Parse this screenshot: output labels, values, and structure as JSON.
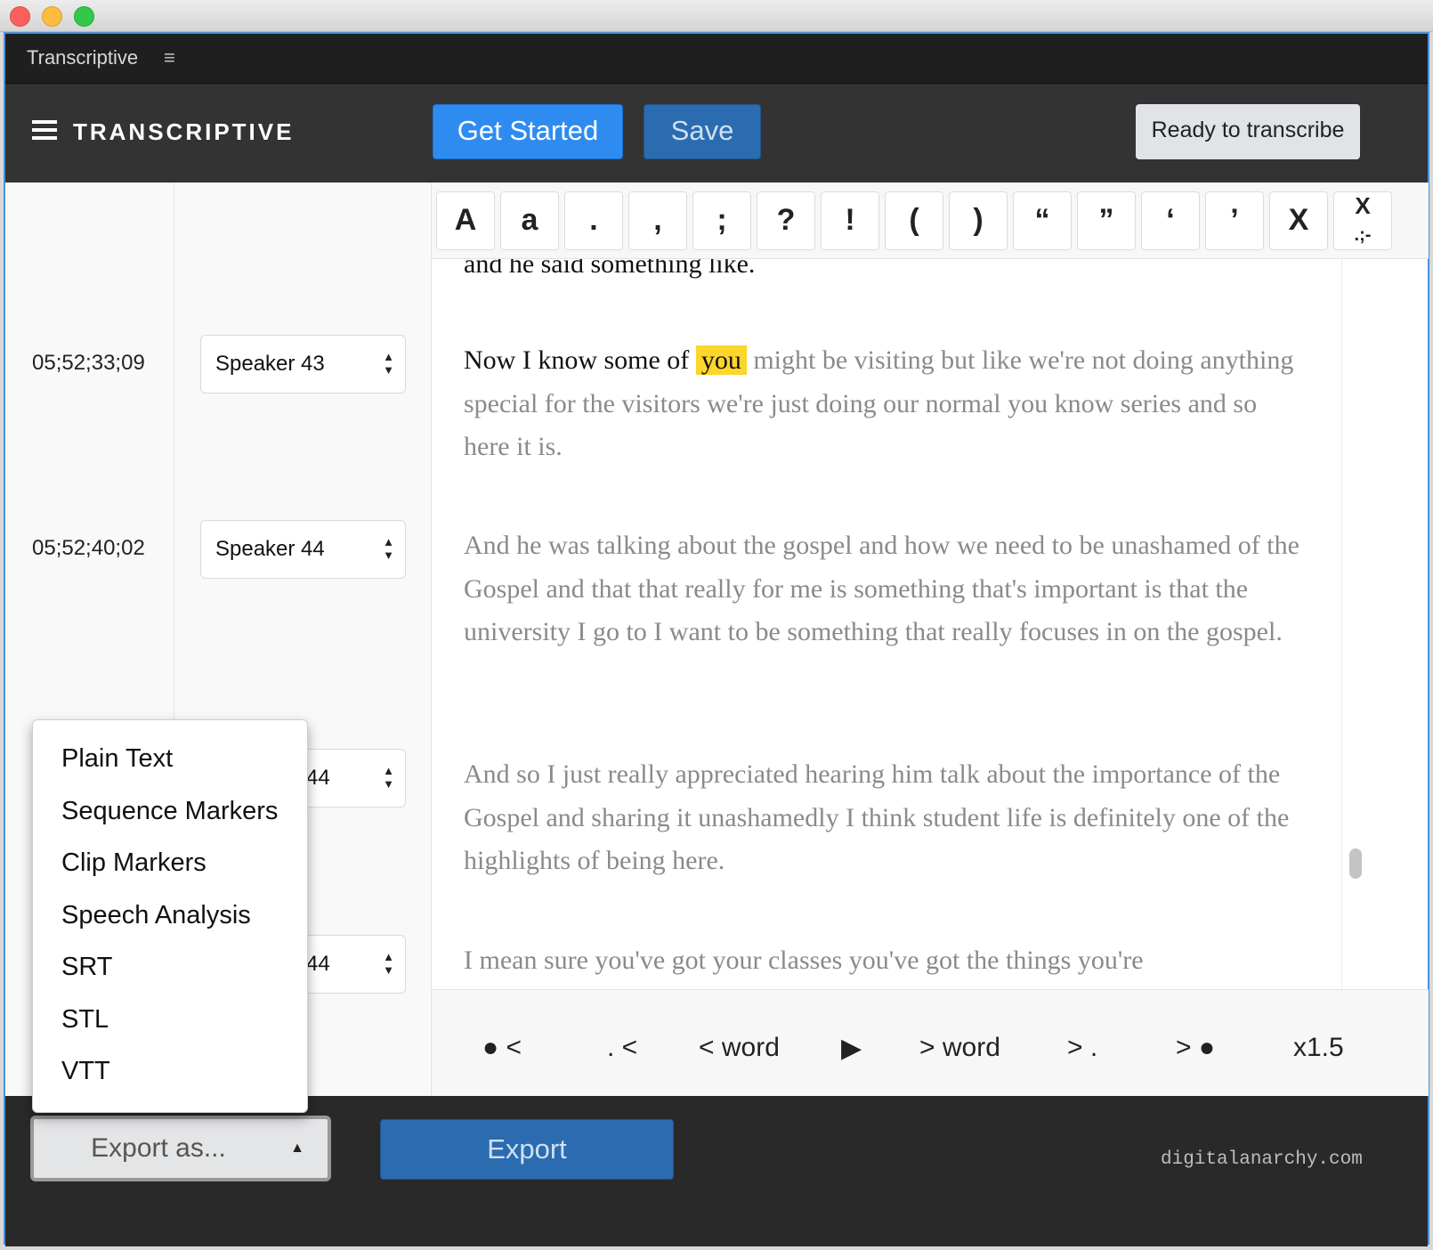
{
  "window": {
    "panel_title": "Transcriptive",
    "panel_menu_icon": "≡",
    "traffic_lights": {
      "close": "#fc605c",
      "minimize": "#fdbc40",
      "zoom": "#34c84a"
    }
  },
  "header": {
    "brand": "TRANSCRIPTIVE",
    "get_started_label": "Get Started",
    "save_label": "Save",
    "status_label": "Ready to transcribe"
  },
  "rows": [
    {
      "timecode": "05;52;33;09",
      "speaker": "Speaker 43"
    },
    {
      "timecode": "05;52;40;02",
      "speaker": "Speaker 44"
    },
    {
      "timecode": "",
      "speaker": "44"
    },
    {
      "timecode": "",
      "speaker": "44"
    }
  ],
  "punctuation_keys": [
    "A",
    "a",
    ".",
    ",",
    ";",
    "?",
    "!",
    "(",
    ")",
    "“",
    "”",
    "‘",
    "’",
    "X",
    "X"
  ],
  "transcript": {
    "clipped_line": "and he said something like.",
    "p1_current": "Now I know some of",
    "p1_highlight": "you",
    "p1_rest": "might be visiting but like we're not doing anything special for the visitors we're just doing our normal you know series and so here it is.",
    "p2": "And he was talking about the gospel and how we need to be unashamed of the Gospel and that that really for me is something that's important is that the university I go to I want to be something that really focuses in on the gospel.",
    "p3": "And so I just really appreciated hearing him talk about the importance of the Gospel and sharing it unashamedly I think student life is definitely one of the highlights of being here.",
    "p4": "I mean sure you've got your classes you've got the things you're"
  },
  "transport": {
    "prev_speaker": "<",
    "prev_sentence": ". <",
    "prev_word": "< word",
    "play_icon": "▶",
    "next_word": "> word",
    "next_sentence": "> .",
    "next_speaker": ">",
    "speed": "x1.5"
  },
  "footer": {
    "export_as_label": "Export as...",
    "export_label": "Export",
    "site": "digitalanarchy.com"
  },
  "export_menu": [
    "Plain Text",
    "Sequence Markers",
    "Clip Markers",
    "Speech Analysis",
    "SRT",
    "STL",
    "VTT"
  ],
  "colors": {
    "accent_blue": "#2e8cf0",
    "highlight_yellow": "#fcd62b",
    "dark_bg": "#292929"
  }
}
